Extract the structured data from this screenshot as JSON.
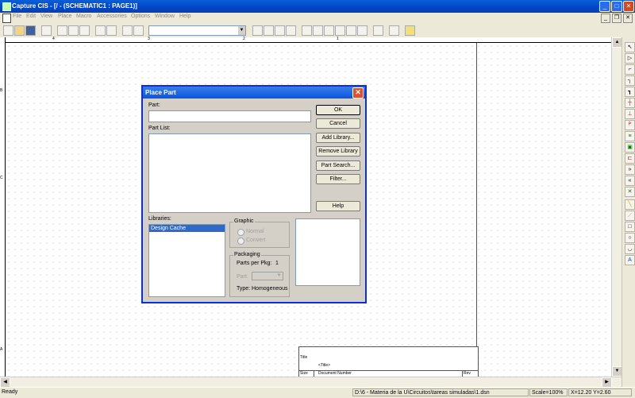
{
  "window": {
    "title": "Capture CIS - [/ - (SCHEMATIC1 : PAGE1)]",
    "buttons": {
      "minimize": "_",
      "maximize": "□",
      "close": "✕"
    }
  },
  "menu": [
    "File",
    "Edit",
    "View",
    "Place",
    "Macro",
    "Accessories",
    "Options",
    "Window",
    "Help"
  ],
  "mdi_buttons": {
    "minimize": "_",
    "restore": "❐",
    "close": "✕"
  },
  "toolbar": {
    "combo_value": ""
  },
  "ruler": {
    "top_marks": [
      "4",
      "3",
      "2",
      "1"
    ],
    "left_marks": [
      "B",
      "C",
      "A"
    ]
  },
  "titleblock": {
    "title_label": "Title",
    "title_value": "<Title>",
    "size_label": "Size",
    "doc_label": "Document Number",
    "rev_label": "Rev"
  },
  "dialog": {
    "title": "Place Part",
    "part_label": "Part:",
    "part_value": "",
    "part_list_label": "Part List:",
    "libraries_label": "Libraries:",
    "libraries": [
      "Design Cache"
    ],
    "buttons": {
      "ok": "OK",
      "cancel": "Cancel",
      "add_library": "Add Library...",
      "remove_library": "Remove Library",
      "part_search": "Part Search...",
      "filter": "Filter...",
      "help": "Help"
    },
    "graphic": {
      "label": "Graphic",
      "normal": "Normal",
      "convert": "Convert"
    },
    "packaging": {
      "label": "Packaging",
      "parts_per_pkg_label": "Parts per Pkg:",
      "parts_per_pkg_value": "1",
      "part_label": "Part:",
      "type_label": "Type:",
      "type_value": "Homogeneous"
    }
  },
  "status": {
    "ready": "Ready",
    "path": "D:\\6 - Materia de la U\\Circuitos\\tareas simuladas\\1.dsn",
    "scale": "Scale=100%",
    "coords": "X=12.20  Y=2.60"
  },
  "icons": {
    "new": "new-file-icon",
    "open": "open-folder-icon",
    "save": "save-icon",
    "print": "print-icon"
  }
}
